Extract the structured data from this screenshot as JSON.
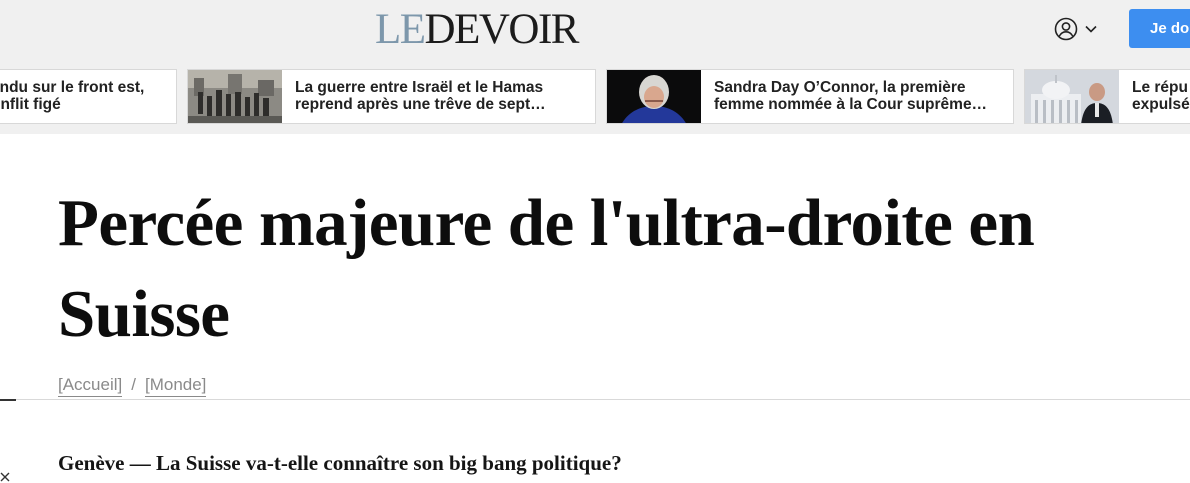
{
  "header": {
    "logo_prefix": "LE",
    "logo_main": "DEVOIR",
    "account_icon": "user-circle-icon",
    "chevron_icon": "chevron-down-icon",
    "donate_label": "Je donne",
    "background_color": "#f0f0f0",
    "donate_color": "#3d8ef0"
  },
  "news_strip": {
    "cards": [
      {
        "line1": "endu sur le front est,",
        "line2": "onflit figé"
      },
      {
        "line1": "La guerre entre Israël et le Hamas",
        "line2": "reprend après une trêve de sept…"
      },
      {
        "line1": "Sandra Day O’Connor, la première",
        "line2": "femme nommée à la Cour suprême…"
      },
      {
        "line1": "Le répu",
        "line2": "expulsé"
      }
    ]
  },
  "article": {
    "headline": "Percée majeure de l'ultra-droite en Suisse",
    "breadcrumb": [
      "[Accueil]",
      "[Monde]"
    ],
    "breadcrumb_separator": "/",
    "lede": "Genève — La Suisse va-t-elle connaître son big bang politique?"
  }
}
